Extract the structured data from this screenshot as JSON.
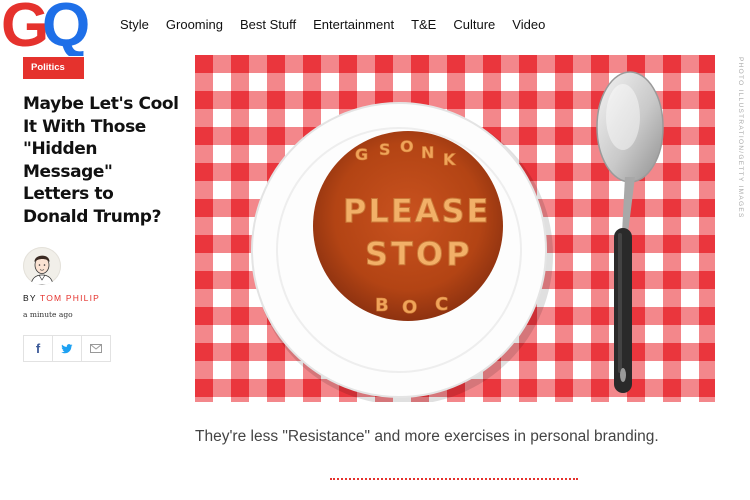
{
  "header": {
    "logo_text": "GQ",
    "nav": [
      "Style",
      "Grooming",
      "Best Stuff",
      "Entertainment",
      "T&E",
      "Culture",
      "Video"
    ]
  },
  "article": {
    "tag": "Politics",
    "headline": "Maybe Let's Cool It With Those \"Hidden Message\" Letters to Donald Trump?",
    "byline_prefix": "BY ",
    "author": "TOM PHILIP",
    "timestamp": "a minute ago",
    "image_credit": "PHOTO ILLUSTRATION/GETTY IMAGES",
    "soup_line1": "PLEASE",
    "soup_line2": "STOP",
    "dek": "They're less \"Resistance\" and more exercises in personal branding."
  },
  "share": {
    "icons": [
      "facebook-icon",
      "twitter-icon",
      "email-icon"
    ],
    "facebook_glyph": "f"
  },
  "colors": {
    "brand_red": "#e5322d",
    "logo_blue": "#1e6fe8",
    "tablecloth_red": "#e8242b"
  }
}
